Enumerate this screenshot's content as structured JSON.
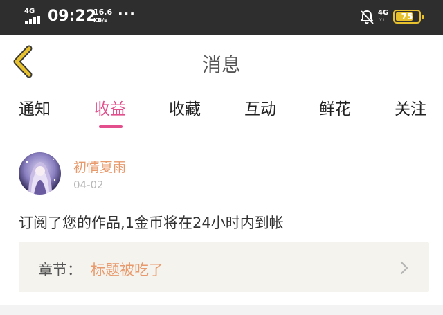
{
  "status_bar": {
    "network_left": "4G",
    "time": "09:22",
    "speed_value": "16.6",
    "speed_unit": "KB/s",
    "more": "···",
    "network_right": "4G",
    "network_right_sub": "Y↑",
    "battery": "75",
    "battery_level": 0.75,
    "icons": [
      "signal-bars-icon",
      "bell-muted-icon",
      "battery-icon"
    ]
  },
  "header": {
    "title": "消息",
    "back_icon": "chevron-left-icon",
    "accent": "#e8c22e"
  },
  "tabs": {
    "items": [
      {
        "label": "通知"
      },
      {
        "label": "收益"
      },
      {
        "label": "收藏"
      },
      {
        "label": "互动"
      },
      {
        "label": "鲜花"
      },
      {
        "label": "关注"
      }
    ],
    "active_index": 1,
    "active_color": "#e24f8c"
  },
  "notification": {
    "user_name": "初情夏雨",
    "date": "04-02",
    "message": "订阅了您的作品,1金币将在24小时内到帐",
    "chapter_label": "章节：",
    "chapter_title": "标题被吃了",
    "chevron_icon": "chevron-right-icon",
    "name_color": "#e89a6c"
  }
}
